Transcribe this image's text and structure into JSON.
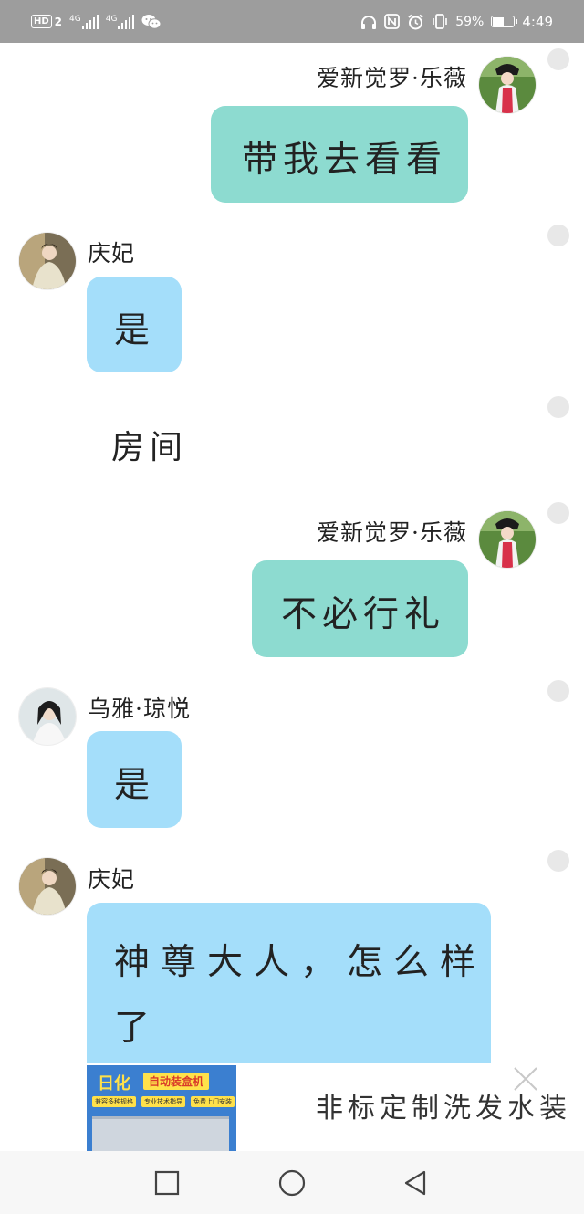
{
  "status_bar": {
    "hd_label": "HD",
    "sim_slot": "2",
    "network_1": "4G",
    "network_2": "4G",
    "battery_percent_text": "59%",
    "battery_level": 0.59,
    "time": "4:49",
    "icons": [
      "wechat-icon",
      "headphones-icon",
      "nfc-icon",
      "alarm-icon",
      "vibrate-icon",
      "battery-icon"
    ]
  },
  "messages": [
    {
      "side": "right",
      "sender": "爱新觉罗·乐薇",
      "text": "带我去看看",
      "bubble_color": "#8ddbd0"
    },
    {
      "side": "left",
      "sender": "庆妃",
      "text": "是",
      "bubble_color": "#a4defa"
    },
    {
      "side": "none",
      "sender": "",
      "text": "房间"
    },
    {
      "side": "right",
      "sender": "爱新觉罗·乐薇",
      "text": "不必行礼",
      "bubble_color": "#8ddbd0"
    },
    {
      "side": "left",
      "sender": "乌雅·琼悦",
      "text": "是",
      "bubble_color": "#a4defa"
    },
    {
      "side": "left",
      "sender": "庆妃",
      "text_line1": "神尊大人，怎么样",
      "text_line2": "了",
      "bubble_color": "#a4defa"
    }
  ],
  "ad": {
    "brand": "日化",
    "tag": "自动装盒机",
    "chips": [
      "兼容多种规格",
      "专业技术指导",
      "免费上门安装"
    ],
    "title": "非标定制洗发水装"
  },
  "nav": {
    "icons": [
      "recent-apps-icon",
      "home-icon",
      "back-icon"
    ]
  }
}
